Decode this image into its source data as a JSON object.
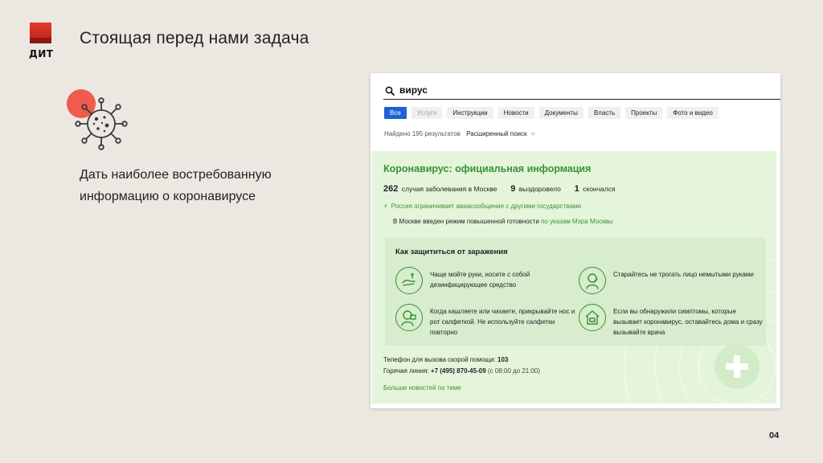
{
  "slide": {
    "title": "Стоящая перед нами задача",
    "tagline": "Дать наиболее востребованную информацию о коронавирусе",
    "page_number": "04",
    "logo_text": "ДИТ",
    "accent": "#ef5b4c"
  },
  "search": {
    "query": "вирус",
    "icon": "search-icon"
  },
  "filters": [
    {
      "label": "Все",
      "active": true
    },
    {
      "label": "Услуги",
      "muted": true
    },
    {
      "label": "Инструкции"
    },
    {
      "label": "Новости"
    },
    {
      "label": "Документы"
    },
    {
      "label": "Власть"
    },
    {
      "label": "Проекты"
    },
    {
      "label": "Фото и видео"
    }
  ],
  "results": {
    "found": "Найдено 195 результатов",
    "advanced": "Расширенный поиск",
    "advanced_icon": "≃"
  },
  "covid": {
    "title": "Коронавирус: официальная информация",
    "stats": [
      {
        "value": "262",
        "label": "случая заболевания в Москве"
      },
      {
        "value": "9",
        "label": "выздоровело"
      },
      {
        "value": "1",
        "label": "скончался"
      }
    ],
    "alert": "Россия ограничивает авиасообщение с другими государствами",
    "regime_text": "В Москве введен режим повышенной готовности",
    "regime_link": "по указам Мэра Москвы",
    "accent": "#3c8f36",
    "panel_bg": "#e4f5dc"
  },
  "tips": {
    "title": "Как защититься от заражения",
    "items": [
      {
        "text": "Чаще мойте руки, носите с собой дезинфицирующее средство",
        "icon": "hand-washing-icon"
      },
      {
        "text": "Старайтесь не трогать лицо немытыми руками",
        "icon": "face-touch-icon"
      },
      {
        "text": "Когда кашляете или чихаете, прикрывайте нос и рот салфеткой. Не используйте салфетки повторно",
        "icon": "sneeze-tissue-icon"
      },
      {
        "text": "Если вы обнаружили симптомы, которые вызывает коронавирус, оставайтесь дома и сразу вызывайте врача",
        "icon": "stay-home-icon"
      }
    ]
  },
  "contacts": {
    "ambulance_label": "Телефон для вызова скорой помощи:",
    "ambulance_number": "103",
    "hotline_label": "Горячая линия:",
    "hotline_number": "+7 (495) 870-45-09",
    "hotline_hours": "(с 08:00 до 21:00)",
    "more_news": "Больше новостей по теме"
  }
}
